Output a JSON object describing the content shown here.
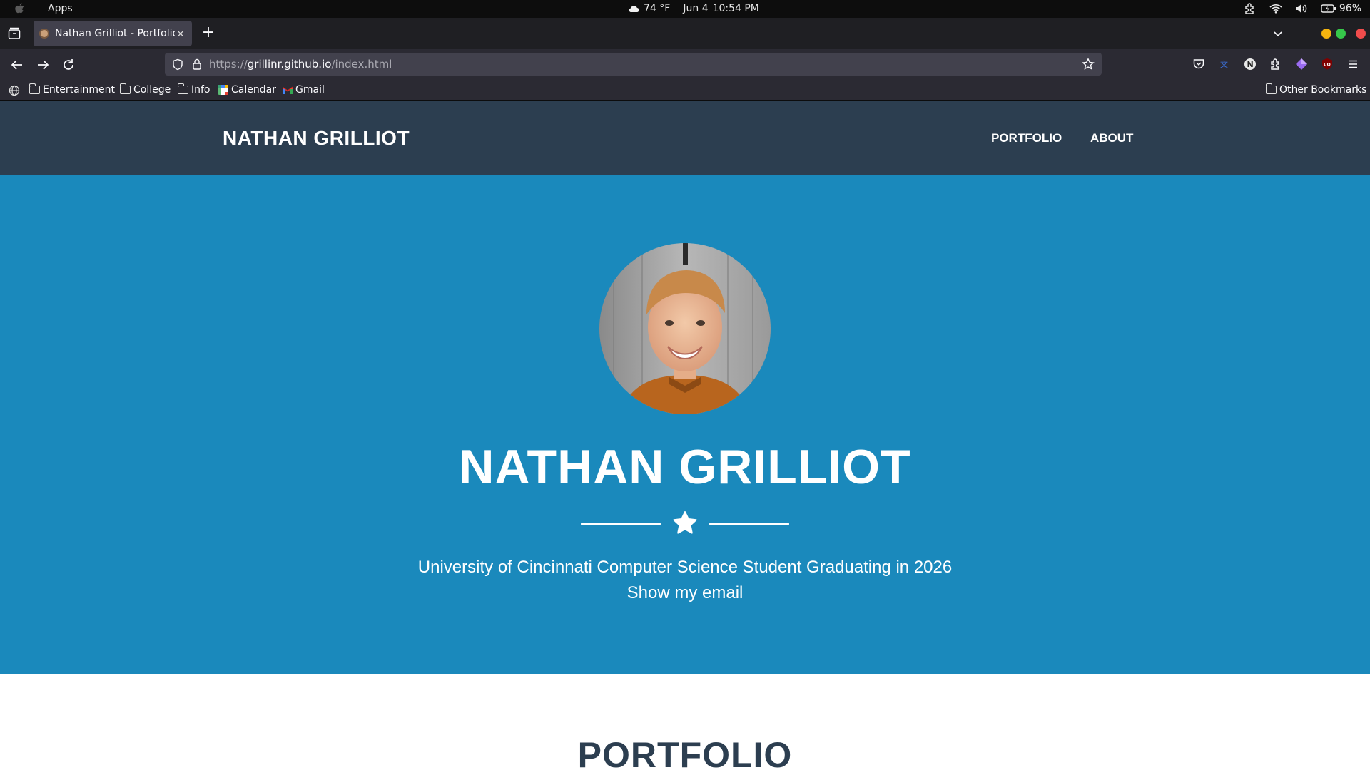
{
  "os": {
    "apps_label": "Apps",
    "weather": "74 °F",
    "date": "Jun 4",
    "time": "10:54 PM",
    "battery": "96%"
  },
  "browser": {
    "tab_title": "Nathan Grilliot - Portfolio",
    "tab_close": "×",
    "new_tab": "+",
    "url_scheme": "https://",
    "url_host": "grillinr.github.io",
    "url_path": "/index.html",
    "bookmarks": [
      "Entertainment",
      "College",
      "Info",
      "Calendar",
      "Gmail"
    ],
    "other_bookmarks": "Other Bookmarks",
    "window_colors": {
      "minimize": "#f5b40f",
      "maximize": "#36c84a",
      "close": "#f04c4c"
    }
  },
  "site": {
    "brand": "NATHAN GRILLIOT",
    "nav": [
      "PORTFOLIO",
      "ABOUT"
    ],
    "hero": {
      "name": "NATHAN GRILLIOT",
      "subtitle": "University of Cincinnati Computer Science Student Graduating in 2026",
      "email_link": "Show my email"
    },
    "section_title": "PORTFOLIO",
    "colors": {
      "navbar": "#2c3e50",
      "hero": "#1a89bc",
      "text": "#ffffff",
      "heading": "#2c3e50"
    }
  }
}
